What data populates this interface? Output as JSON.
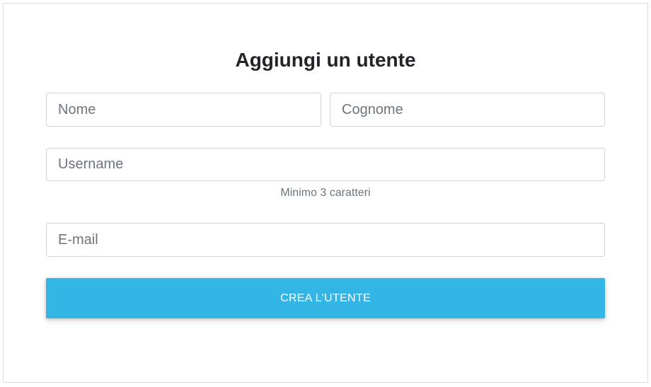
{
  "form": {
    "title": "Aggiungi un utente",
    "first_name": {
      "placeholder": "Nome",
      "value": ""
    },
    "last_name": {
      "placeholder": "Cognome",
      "value": ""
    },
    "username": {
      "placeholder": "Username",
      "value": "",
      "hint": "Minimo 3 caratteri"
    },
    "email": {
      "placeholder": "E-mail",
      "value": ""
    },
    "submit_label": "CREA L'UTENTE"
  },
  "colors": {
    "accent": "#33b5e5",
    "border": "#ced4da",
    "hint_text": "#6c757d",
    "title_text": "#212529"
  }
}
